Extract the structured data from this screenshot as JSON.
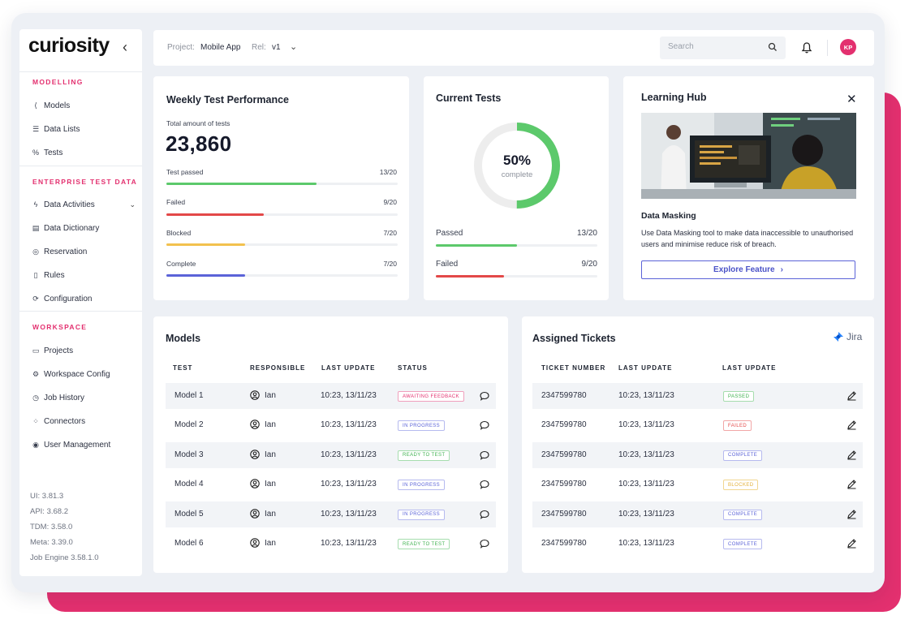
{
  "app": {
    "logo": "curiosity"
  },
  "sidebar": {
    "sections": [
      {
        "title": "MODELLING",
        "items": [
          {
            "label": "Models",
            "icon": "share-nodes-icon"
          },
          {
            "label": "Data Lists",
            "icon": "list-icon"
          },
          {
            "label": "Tests",
            "icon": "percent-icon"
          }
        ]
      },
      {
        "title": "ENTERPRISE TEST DATA",
        "items": [
          {
            "label": "Data Activities",
            "icon": "bolt-icon"
          },
          {
            "label": "Data Dictionary",
            "icon": "book-icon"
          },
          {
            "label": "Reservation",
            "icon": "target-icon"
          },
          {
            "label": "Rules",
            "icon": "clipboard-icon"
          },
          {
            "label": "Configuration",
            "icon": "sync-icon"
          }
        ]
      },
      {
        "title": "WORKSPACE",
        "items": [
          {
            "label": "Projects",
            "icon": "folder-icon"
          },
          {
            "label": "Workspace Config",
            "icon": "gear-icon"
          },
          {
            "label": "Job History",
            "icon": "clock-icon"
          },
          {
            "label": "Connectors",
            "icon": "grid-icon"
          },
          {
            "label": "User Management",
            "icon": "user-circle-icon"
          }
        ]
      }
    ],
    "versions": [
      "UI: 3.81.3",
      "API: 3.68.2",
      "TDM: 3.58.0",
      "Meta: 3.39.0",
      "Job Engine 3.58.1.0"
    ]
  },
  "topbar": {
    "project_label": "Project:",
    "project_value": "Mobile App",
    "rel_label": "Rel:",
    "rel_value": "v1",
    "search_placeholder": "Search",
    "avatar_initials": "KP"
  },
  "weekly": {
    "title": "Weekly Test Performance",
    "subtitle": "Total amount of tests",
    "total": "23,860",
    "bars": [
      {
        "label": "Test passed",
        "count": "13/20",
        "fraction": 0.65,
        "color": "#5cc96b"
      },
      {
        "label": "Failed",
        "count": "9/20",
        "fraction": 0.42,
        "color": "#e34848"
      },
      {
        "label": "Blocked",
        "count": "7/20",
        "fraction": 0.34,
        "color": "#f2c14e"
      },
      {
        "label": "Complete",
        "count": "7/20",
        "fraction": 0.34,
        "color": "#5b63d8"
      }
    ]
  },
  "current": {
    "title": "Current Tests",
    "percent": "50%",
    "percent_label": "complete",
    "progress": 0.5,
    "bars": [
      {
        "label": "Passed",
        "count": "13/20",
        "fraction": 0.5,
        "color": "#5cc96b"
      },
      {
        "label": "Failed",
        "count": "9/20",
        "fraction": 0.42,
        "color": "#e34848"
      }
    ]
  },
  "hub": {
    "title": "Learning Hub",
    "heading": "Data Masking",
    "description": "Use Data Masking tool to make data inaccessible to unauthorised users and minimise reduce risk of breach.",
    "button": "Explore Feature"
  },
  "models": {
    "title": "Models",
    "columns": [
      "TEST",
      "RESPONSIBLE",
      "LAST UPDATE",
      "STATUS"
    ],
    "rows": [
      {
        "test": "Model 1",
        "responsible": "Ian",
        "updated": "10:23, 13/11/23",
        "status": "AWAITING FEEDBACK",
        "kind": "awaiting"
      },
      {
        "test": "Model 2",
        "responsible": "Ian",
        "updated": "10:23, 13/11/23",
        "status": "IN PROGRESS",
        "kind": "progress"
      },
      {
        "test": "Model 3",
        "responsible": "Ian",
        "updated": "10:23, 13/11/23",
        "status": "READY TO TEST",
        "kind": "ready"
      },
      {
        "test": "Model 4",
        "responsible": "Ian",
        "updated": "10:23, 13/11/23",
        "status": "IN PROGRESS",
        "kind": "progress"
      },
      {
        "test": "Model 5",
        "responsible": "Ian",
        "updated": "10:23, 13/11/23",
        "status": "IN PROGRESS",
        "kind": "progress"
      },
      {
        "test": "Model 6",
        "responsible": "Ian",
        "updated": "10:23, 13/11/23",
        "status": "READY TO TEST",
        "kind": "ready"
      }
    ]
  },
  "tickets": {
    "title": "Assigned Tickets",
    "brand": "Jira",
    "columns": [
      "TICKET NUMBER",
      "LAST UPDATE",
      "LAST UPDATE"
    ],
    "rows": [
      {
        "number": "2347599780",
        "updated": "10:23, 13/11/23",
        "status": "PASSED",
        "kind": "passed"
      },
      {
        "number": "2347599780",
        "updated": "10:23, 13/11/23",
        "status": "FAILED",
        "kind": "failed"
      },
      {
        "number": "2347599780",
        "updated": "10:23, 13/11/23",
        "status": "COMPLETE",
        "kind": "complete"
      },
      {
        "number": "2347599780",
        "updated": "10:23, 13/11/23",
        "status": "BLOCKED",
        "kind": "blocked"
      },
      {
        "number": "2347599780",
        "updated": "10:23, 13/11/23",
        "status": "COMPLETE",
        "kind": "complete"
      },
      {
        "number": "2347599780",
        "updated": "10:23, 13/11/23",
        "status": "COMPLETE",
        "kind": "complete"
      }
    ]
  }
}
